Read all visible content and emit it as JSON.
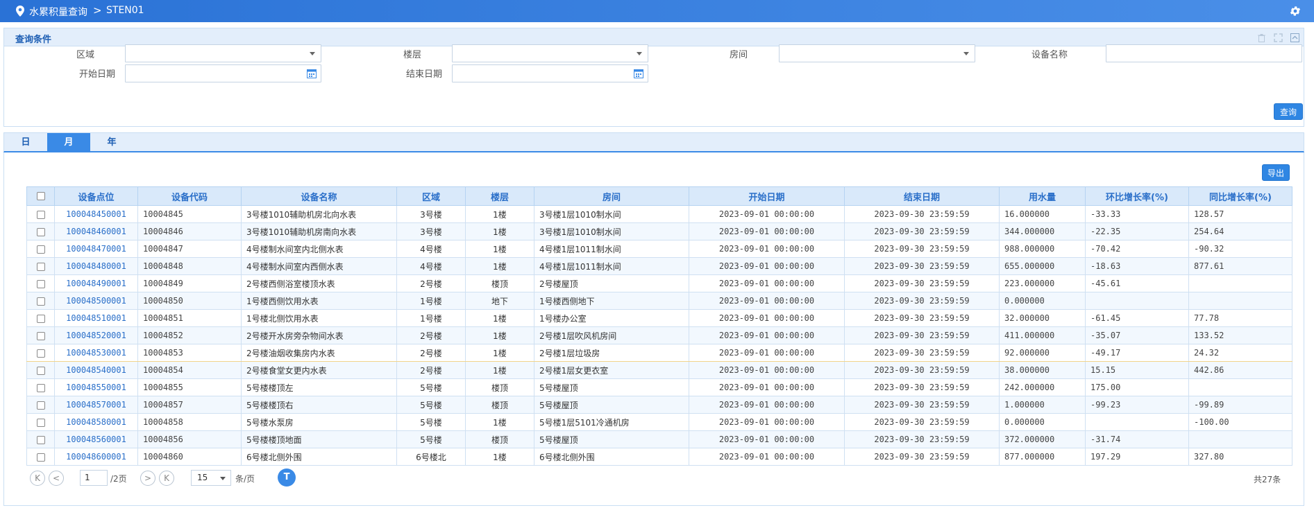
{
  "header": {
    "breadcrumb_1": "水累积量查询",
    "separator": ">",
    "breadcrumb_2": "STEN01"
  },
  "query": {
    "title": "查询条件",
    "region_label": "区域",
    "floor_label": "楼层",
    "room_label": "房间",
    "device_name_label": "设备名称",
    "start_date_label": "开始日期",
    "end_date_label": "结束日期",
    "query_button": "查询"
  },
  "tabs": [
    "日",
    "月",
    "年"
  ],
  "export_button": "导出",
  "table": {
    "columns": [
      "设备点位",
      "设备代码",
      "设备名称",
      "区域",
      "楼层",
      "房间",
      "开始日期",
      "结束日期",
      "用水量",
      "环比增长率(%)",
      "同比增长率(%)"
    ],
    "rows": [
      [
        "100048450001",
        "10004845",
        "3号楼1010辅助机房北向水表",
        "3号楼",
        "1楼",
        "3号楼1层1010制水间",
        "2023-09-01 00:00:00",
        "2023-09-30 23:59:59",
        "16.000000",
        "-33.33",
        "128.57"
      ],
      [
        "100048460001",
        "10004846",
        "3号楼1010辅助机房南向水表",
        "3号楼",
        "1楼",
        "3号楼1层1010制水间",
        "2023-09-01 00:00:00",
        "2023-09-30 23:59:59",
        "344.000000",
        "-22.35",
        "254.64"
      ],
      [
        "100048470001",
        "10004847",
        "4号楼制水间室内北侧水表",
        "4号楼",
        "1楼",
        "4号楼1层1011制水间",
        "2023-09-01 00:00:00",
        "2023-09-30 23:59:59",
        "988.000000",
        "-70.42",
        "-90.32"
      ],
      [
        "100048480001",
        "10004848",
        "4号楼制水间室内西侧水表",
        "4号楼",
        "1楼",
        "4号楼1层1011制水间",
        "2023-09-01 00:00:00",
        "2023-09-30 23:59:59",
        "655.000000",
        "-18.63",
        "877.61"
      ],
      [
        "100048490001",
        "10004849",
        "2号楼西侧浴室楼顶水表",
        "2号楼",
        "楼顶",
        "2号楼屋顶",
        "2023-09-01 00:00:00",
        "2023-09-30 23:59:59",
        "223.000000",
        "-45.61",
        ""
      ],
      [
        "100048500001",
        "10004850",
        "1号楼西侧饮用水表",
        "1号楼",
        "地下",
        "1号楼西侧地下",
        "2023-09-01 00:00:00",
        "2023-09-30 23:59:59",
        "0.000000",
        "",
        ""
      ],
      [
        "100048510001",
        "10004851",
        "1号楼北侧饮用水表",
        "1号楼",
        "1楼",
        "1号楼办公室",
        "2023-09-01 00:00:00",
        "2023-09-30 23:59:59",
        "32.000000",
        "-61.45",
        "77.78"
      ],
      [
        "100048520001",
        "10004852",
        "2号楼开水房旁杂物间水表",
        "2号楼",
        "1楼",
        "2号楼1层吹风机房间",
        "2023-09-01 00:00:00",
        "2023-09-30 23:59:59",
        "411.000000",
        "-35.07",
        "133.52"
      ],
      [
        "100048530001",
        "10004853",
        "2号楼油烟收集房内水表",
        "2号楼",
        "1楼",
        "2号楼1层垃圾房",
        "2023-09-01 00:00:00",
        "2023-09-30 23:59:59",
        "92.000000",
        "-49.17",
        "24.32"
      ],
      [
        "100048540001",
        "10004854",
        "2号楼食堂女更内水表",
        "2号楼",
        "1楼",
        "2号楼1层女更衣室",
        "2023-09-01 00:00:00",
        "2023-09-30 23:59:59",
        "38.000000",
        "15.15",
        "442.86"
      ],
      [
        "100048550001",
        "10004855",
        "5号楼楼顶左",
        "5号楼",
        "楼顶",
        "5号楼屋顶",
        "2023-09-01 00:00:00",
        "2023-09-30 23:59:59",
        "242.000000",
        "175.00",
        ""
      ],
      [
        "100048570001",
        "10004857",
        "5号楼楼顶右",
        "5号楼",
        "楼顶",
        "5号楼屋顶",
        "2023-09-01 00:00:00",
        "2023-09-30 23:59:59",
        "1.000000",
        "-99.23",
        "-99.89"
      ],
      [
        "100048580001",
        "10004858",
        "5号楼水泵房",
        "5号楼",
        "1楼",
        "5号楼1层5101冷通机房",
        "2023-09-01 00:00:00",
        "2023-09-30 23:59:59",
        "0.000000",
        "",
        "-100.00"
      ],
      [
        "100048560001",
        "10004856",
        "5号楼楼顶地面",
        "5号楼",
        "楼顶",
        "5号楼屋顶",
        "2023-09-01 00:00:00",
        "2023-09-30 23:59:59",
        "372.000000",
        "-31.74",
        ""
      ],
      [
        "100048600001",
        "10004860",
        "6号楼北侧外围",
        "6号楼北",
        "1楼",
        "6号楼北侧外围",
        "2023-09-01 00:00:00",
        "2023-09-30 23:59:59",
        "877.000000",
        "197.29",
        "327.80"
      ]
    ]
  },
  "pager": {
    "first": "K",
    "prev": "<",
    "page": "1",
    "total_pages": "/2页",
    "next": ">",
    "last": "K",
    "page_size": "15",
    "per_page": "条/页",
    "refresh": "T",
    "total": "共27条"
  }
}
